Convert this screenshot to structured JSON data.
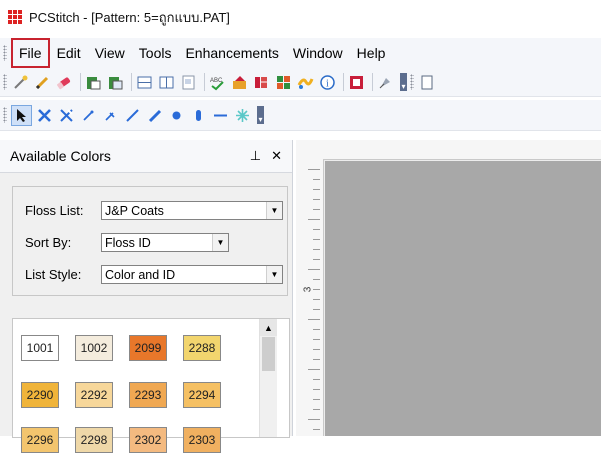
{
  "window": {
    "title": "PCStitch - [Pattern: 5=ถูกแบบ.PAT]"
  },
  "menu": {
    "items": [
      "File",
      "Edit",
      "View",
      "Tools",
      "Enhancements",
      "Window",
      "Help"
    ]
  },
  "toolbar1": {
    "icons": [
      "wand-icon",
      "pencil-icon",
      "eraser-icon",
      "paste-icon",
      "copy-icon",
      "grid-icon",
      "columns-icon",
      "page-icon",
      "abc-spell-icon",
      "palette-icon",
      "floss-icon",
      "color-pick-icon",
      "wave-icon",
      "info-icon",
      "brand-icon",
      "pin-icon",
      "new-document-icon"
    ]
  },
  "toolbar2": {
    "icons": [
      "select-arrow-icon",
      "full-stitch-icon",
      "half-cross-icon",
      "backstitch-icon",
      "quarter-stitch-icon",
      "line-icon",
      "diagonal-line-icon",
      "french-knot-icon",
      "bead-icon",
      "straight-line-icon",
      "star-icon"
    ]
  },
  "panel": {
    "title": "Available Colors",
    "pin_glyph": "⊥",
    "close_glyph": "✕",
    "floss_list_label": "Floss List:",
    "floss_list_value": "J&P Coats",
    "sort_by_label": "Sort By:",
    "sort_by_value": "Floss ID",
    "list_style_label": "List Style:",
    "list_style_value": "Color and ID"
  },
  "swatches": [
    {
      "id": "1001",
      "color": "#ffffff"
    },
    {
      "id": "1002",
      "color": "#f4ecdd"
    },
    {
      "id": "2099",
      "color": "#e8772a"
    },
    {
      "id": "2288",
      "color": "#f2d56e"
    },
    {
      "id": "2290",
      "color": "#f0b43a"
    },
    {
      "id": "2292",
      "color": "#f7d79a"
    },
    {
      "id": "2293",
      "color": "#f0a852"
    },
    {
      "id": "2294",
      "color": "#f5c063"
    },
    {
      "id": "2296",
      "color": "#f3c56e"
    },
    {
      "id": "2298",
      "color": "#efd8a8"
    },
    {
      "id": "2302",
      "color": "#f4ba80"
    },
    {
      "id": "2303",
      "color": "#f0b060"
    }
  ],
  "canvas": {
    "ruler_label": "3"
  },
  "colors": {
    "highlight": "#c8232f",
    "canvas": "#a8a8a8"
  }
}
